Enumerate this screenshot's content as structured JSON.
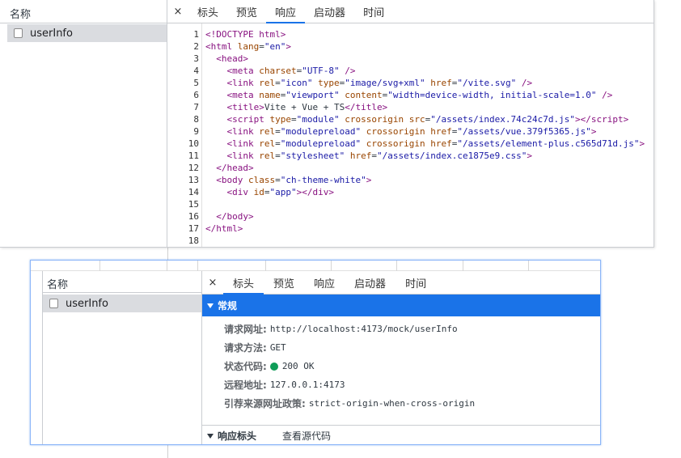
{
  "top_panel": {
    "list_header": "名称",
    "request_name": "userInfo",
    "close_glyph": "×",
    "tabs": [
      {
        "label": "标头"
      },
      {
        "label": "预览"
      },
      {
        "label": "响应"
      },
      {
        "label": "启动器"
      },
      {
        "label": "时间"
      }
    ],
    "active_tab": "响应",
    "line_numbers": [
      "1",
      "2",
      "3",
      "4",
      "5",
      "6",
      "7",
      "8",
      "9",
      "10",
      "11",
      "12",
      "13",
      "14",
      "15",
      "16",
      "17",
      "18"
    ]
  },
  "bottom_panel": {
    "list_header": "名称",
    "request_name": "userInfo",
    "close_glyph": "×",
    "tabs": [
      {
        "label": "标头"
      },
      {
        "label": "预览"
      },
      {
        "label": "响应"
      },
      {
        "label": "启动器"
      },
      {
        "label": "时间"
      }
    ],
    "active_tab": "标头",
    "general": {
      "title": "常规",
      "request_url_label": "请求网址:",
      "request_url": "http://localhost:4173/mock/userInfo",
      "request_method_label": "请求方法:",
      "request_method": "GET",
      "status_code_label": "状态代码:",
      "status_code": "200 OK",
      "remote_address_label": "远程地址:",
      "remote_address": "127.0.0.1:4173",
      "referrer_policy_label": "引荐来源网址政策:",
      "referrer_policy": "strict-origin-when-cross-origin"
    },
    "response_headers": {
      "title": "响应标头",
      "view_source": "查看源代码"
    }
  },
  "colors": {
    "accent": "#1a73e8",
    "selected_row": "#dadce0",
    "status_ok": "#0f9d58",
    "tag": "#881280",
    "attr": "#994500",
    "value": "#1a1aa6"
  },
  "icons": [
    "close-icon",
    "checkbox-icon",
    "disclosure-triangle-icon",
    "status-dot-icon"
  ]
}
